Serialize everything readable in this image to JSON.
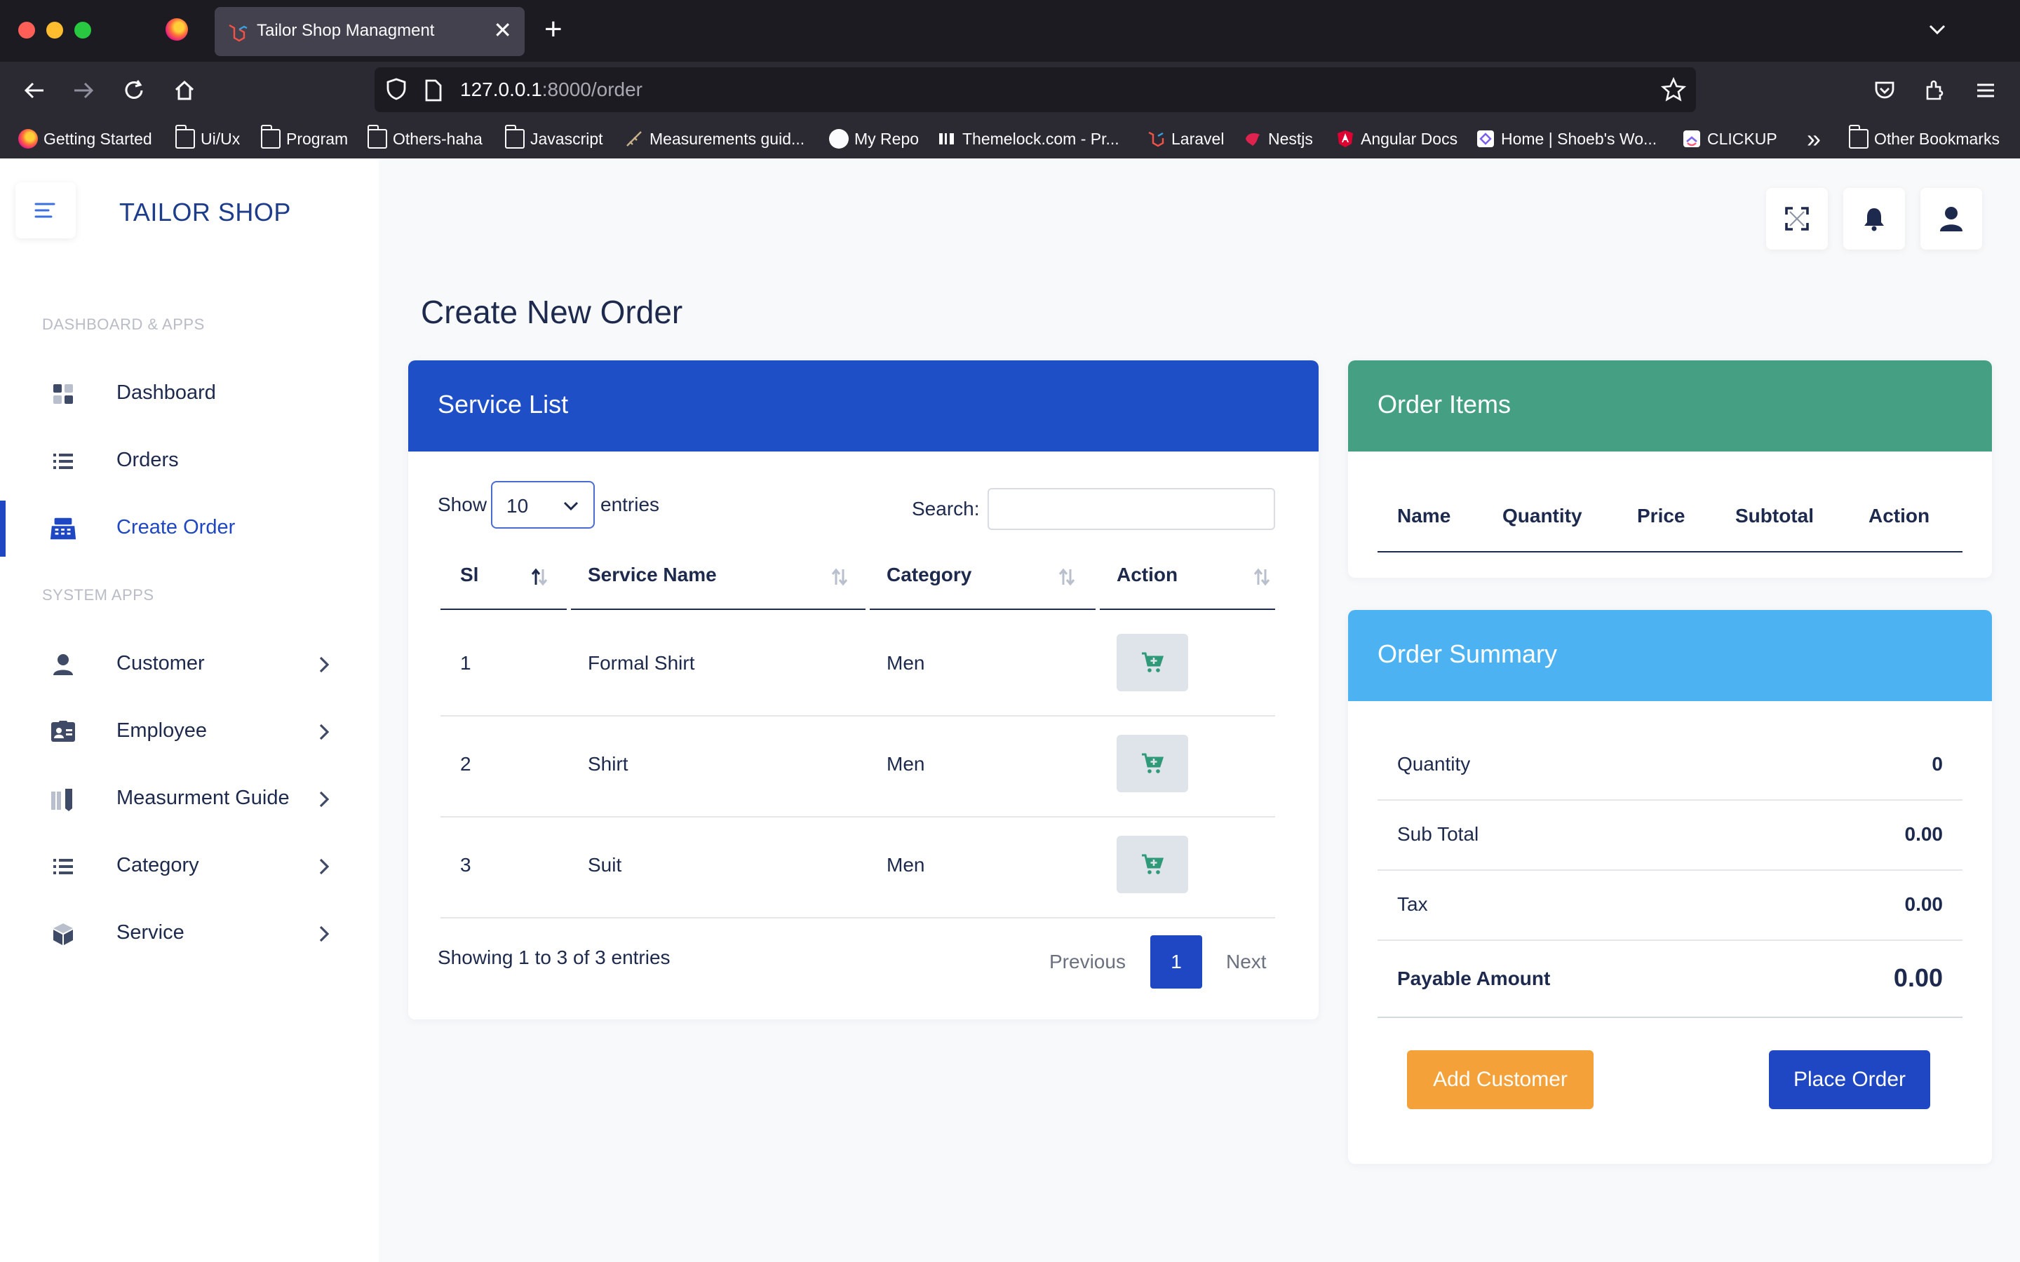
{
  "browser": {
    "tab_title": "Tailor Shop Managment",
    "new_tab_symbol": "+",
    "close_symbol": "✕",
    "url_host": "127.0.0.1",
    "url_rest": ":8000/order",
    "bookmarks": [
      {
        "label": "Getting Started",
        "icon": "firefox-icon"
      },
      {
        "label": "Ui/Ux",
        "icon": "folder-icon"
      },
      {
        "label": "Program",
        "icon": "folder-icon"
      },
      {
        "label": "Others-haha",
        "icon": "folder-icon"
      },
      {
        "label": "Javascript",
        "icon": "folder-icon"
      },
      {
        "label": "Measurements guid...",
        "icon": "measure-icon"
      },
      {
        "label": "My Repo",
        "icon": "github-icon"
      },
      {
        "label": "Themelock.com - Pr...",
        "icon": "themelock-icon"
      },
      {
        "label": "Laravel",
        "icon": "laravel-icon"
      },
      {
        "label": "Nestjs",
        "icon": "nestjs-icon"
      },
      {
        "label": "Angular Docs",
        "icon": "angular-icon"
      },
      {
        "label": "Home | Shoeb's Wo...",
        "icon": "site-icon"
      },
      {
        "label": "CLICKUP",
        "icon": "clickup-icon"
      }
    ],
    "overflow_symbol": "»",
    "other_bookmarks": "Other Bookmarks"
  },
  "sidebar": {
    "brand": "TAILOR SHOP",
    "section1": "DASHBOARD & APPS",
    "section2": "SYSTEM APPS",
    "items": [
      {
        "label": "Dashboard",
        "icon": "dashboard-icon"
      },
      {
        "label": "Orders",
        "icon": "list-icon"
      },
      {
        "label": "Create Order",
        "icon": "cash-register-icon",
        "active": true
      },
      {
        "label": "Customer",
        "icon": "user-icon"
      },
      {
        "label": "Employee",
        "icon": "id-card-icon"
      },
      {
        "label": "Measurment Guide",
        "icon": "ruler-icon"
      },
      {
        "label": "Category",
        "icon": "list-icon"
      },
      {
        "label": "Service",
        "icon": "cube-icon"
      }
    ]
  },
  "header": {
    "buttons": [
      "fullscreen-icon",
      "bell-icon",
      "user-icon"
    ]
  },
  "page_title": "Create New Order",
  "service_list": {
    "title": "Service List",
    "show_label": "Show",
    "entries_value": "10",
    "entries_label": "entries",
    "search_label": "Search:",
    "search_value": "",
    "columns": [
      "Sl",
      "Service Name",
      "Category",
      "Action"
    ],
    "rows": [
      {
        "sl": "1",
        "name": "Formal Shirt",
        "category": "Men"
      },
      {
        "sl": "2",
        "name": "Shirt",
        "category": "Men"
      },
      {
        "sl": "3",
        "name": "Suit",
        "category": "Men"
      }
    ],
    "info": "Showing 1 to 3 of 3 entries",
    "prev": "Previous",
    "page": "1",
    "next": "Next"
  },
  "order_items": {
    "title": "Order Items",
    "columns": [
      "Name",
      "Quantity",
      "Price",
      "Subtotal",
      "Action"
    ]
  },
  "order_summary": {
    "title": "Order Summary",
    "quantity_label": "Quantity",
    "quantity_value": "0",
    "subtotal_label": "Sub Total",
    "subtotal_value": "0.00",
    "tax_label": "Tax",
    "tax_value": "0.00",
    "payable_label": "Payable Amount",
    "payable_value": "0.00",
    "add_customer": "Add Customer",
    "place_order": "Place Order"
  },
  "colors": {
    "service_header": "#1f4fc6",
    "items_header": "#45a083",
    "summary_header": "#4db2f2",
    "primary": "#1f47c3",
    "warning": "#f5a13a",
    "cart_icon": "#2e9a78"
  }
}
